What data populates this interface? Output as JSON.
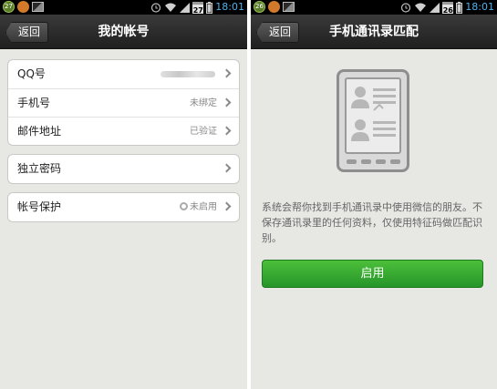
{
  "left": {
    "statusbar": {
      "badge": "27",
      "calendar": "27",
      "time": "18:01"
    },
    "header": {
      "back_label": "返回",
      "title": "我的帐号"
    },
    "account_group": [
      {
        "label": "QQ号",
        "value": ""
      },
      {
        "label": "手机号",
        "value": "未绑定"
      },
      {
        "label": "邮件地址",
        "value": "已验证"
      }
    ],
    "password": {
      "label": "独立密码"
    },
    "protection": {
      "label": "帐号保护",
      "value": "未启用"
    }
  },
  "right": {
    "statusbar": {
      "badge": "26",
      "calendar": "26",
      "time": "18:01"
    },
    "header": {
      "back_label": "返回",
      "title": "手机通讯录匹配"
    },
    "description": "系统会帮你找到手机通讯录中使用微信的朋友。不保存通讯录里的任何资料，仅使用特征码做匹配识别。",
    "enable_button": "启用"
  },
  "colors": {
    "accent_time": "#4fb1ea",
    "button_green": "#26952a"
  }
}
